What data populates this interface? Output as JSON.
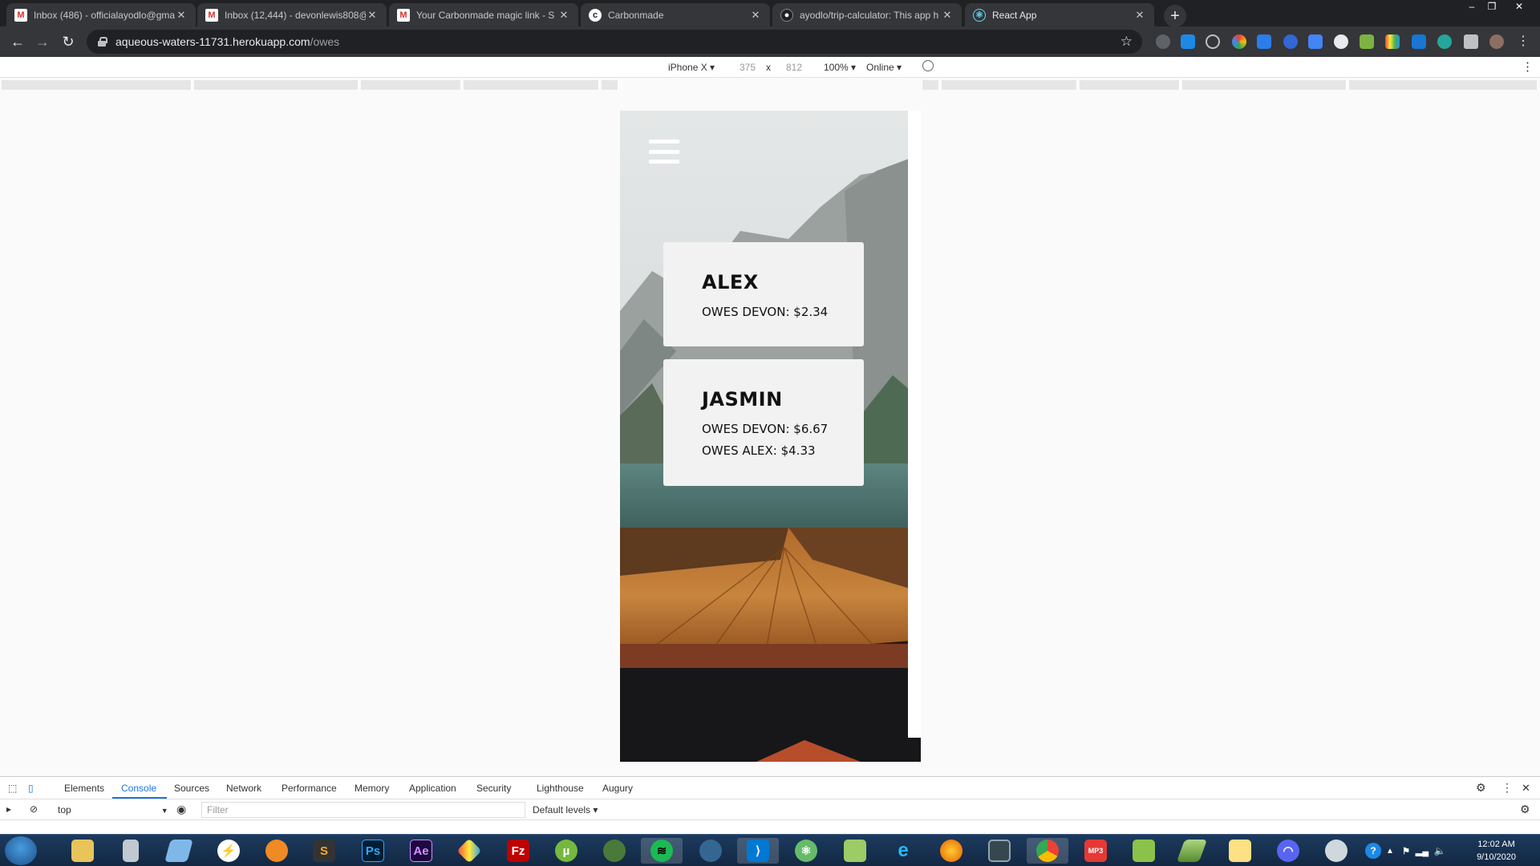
{
  "browser": {
    "tabs": [
      {
        "title": "Inbox (486) - officialayodlo@gma",
        "favicon": "gmail-icon"
      },
      {
        "title": "Inbox (12,444) - devonlewis808@",
        "favicon": "gmail-icon"
      },
      {
        "title": "Your Carbonmade magic link - S",
        "favicon": "gmail-icon"
      },
      {
        "title": "Carbonmade",
        "favicon": "carbonmade-icon"
      },
      {
        "title": "ayodlo/trip-calculator: This app h",
        "favicon": "github-icon"
      },
      {
        "title": "React App",
        "favicon": "react-icon",
        "active": true
      }
    ],
    "new_tab": "+",
    "url_host": "aqueous-waters-11731.herokuapp.com",
    "url_path": "/owes"
  },
  "device_toolbar": {
    "device": "iPhone X",
    "width": "375",
    "x": "x",
    "height": "812",
    "zoom": "100%",
    "network": "Online"
  },
  "app": {
    "cards": [
      {
        "name": "ALEX",
        "owes": [
          "OWES DEVON: $2.34"
        ]
      },
      {
        "name": "JASMIN",
        "owes": [
          "OWES DEVON: $6.67",
          "OWES ALEX: $4.33"
        ]
      }
    ]
  },
  "devtools": {
    "tabs": [
      "Elements",
      "Console",
      "Sources",
      "Network",
      "Performance",
      "Memory",
      "Application",
      "Security",
      "Lighthouse",
      "Augury"
    ],
    "active_tab": "Console",
    "context": "top",
    "filter_placeholder": "Filter",
    "levels": "Default levels"
  },
  "taskbar": {
    "time": "12:02 AM",
    "date": "9/10/2020"
  },
  "colors": {
    "chrome_dark": "#202124",
    "tab_active": "#35363a",
    "card_bg": "#f2f2f2",
    "devtools_accent": "#1a73e8"
  }
}
